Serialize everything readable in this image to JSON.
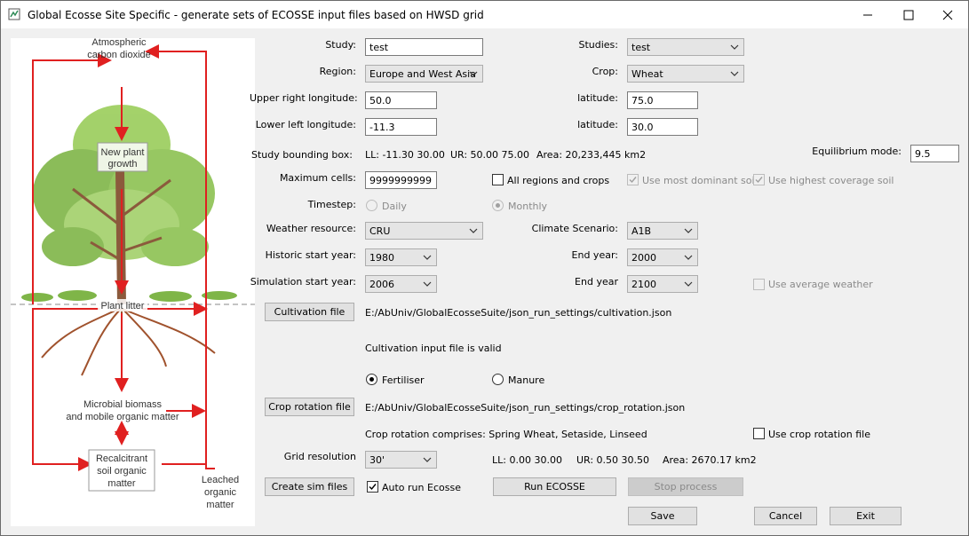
{
  "window": {
    "title": "Global Ecosse Site Specific - generate sets of ECOSSE input files based on HWSD grid"
  },
  "diagram": {
    "co2": [
      "Atmospheric",
      "carbon dioxide"
    ],
    "plant": [
      "New plant",
      "growth"
    ],
    "litter": "Plant litter",
    "microbial": [
      "Microbial biomass",
      "and mobile organic matter"
    ],
    "recalcitrant": [
      "Recalcitrant",
      "soil organic",
      "matter"
    ],
    "leached": [
      "Leached",
      "organic",
      "matter"
    ]
  },
  "form": {
    "study_label": "Study:",
    "study_value": "test",
    "studies_label": "Studies:",
    "studies_value": "test",
    "region_label": "Region:",
    "region_value": "Europe and West Asia",
    "crop_label": "Crop:",
    "crop_value": "Wheat",
    "ur_lon_label": "Upper right longitude:",
    "ur_lon_value": "50.0",
    "ur_lat_label": "latitude:",
    "ur_lat_value": "75.0",
    "ll_lon_label": "Lower left longitude:",
    "ll_lon_value": "-11.3",
    "ll_lat_label": "latitude:",
    "ll_lat_value": "30.0",
    "bbox_label": "Study bounding box:",
    "bbox_ll": "LL: -11.30 30.00",
    "bbox_ur": "UR: 50.00 75.00",
    "bbox_area": "Area: 20,233,445 km2",
    "equil_label": "Equilibrium mode:",
    "equil_value": "9.5",
    "maxcells_label": "Maximum cells:",
    "maxcells_value": "9999999999",
    "all_regions_label": "All regions and crops",
    "dominant_soil_label": "Use most dominant soil",
    "highest_cov_label": "Use highest coverage soil",
    "timestep_label": "Timestep:",
    "daily_label": "Daily",
    "monthly_label": "Monthly",
    "weather_label": "Weather resource:",
    "weather_value": "CRU",
    "climate_label": "Climate Scenario:",
    "climate_value": "A1B",
    "hist_start_label": "Historic start year:",
    "hist_start_value": "1980",
    "hist_end_label": "End year:",
    "hist_end_value": "2000",
    "sim_start_label": "Simulation start year:",
    "sim_start_value": "2006",
    "sim_end_label": "End year",
    "sim_end_value": "2100",
    "avg_weather_label": "Use average weather",
    "cultivation_btn": "Cultivation file",
    "cultivation_path": "E:/AbUniv/GlobalEcosseSuite/json_run_settings/cultivation.json",
    "cultivation_status": "Cultivation input file is valid",
    "fertiliser_label": "Fertiliser",
    "manure_label": "Manure",
    "rotation_btn": "Crop rotation file",
    "rotation_path": "E:/AbUniv/GlobalEcosseSuite/json_run_settings/crop_rotation.json",
    "rotation_comprises": "Crop rotation comprises: Spring Wheat, Setaside, Linseed",
    "use_rotation_label": "Use crop rotation file",
    "grid_label": "Grid resolution",
    "grid_value": "30'",
    "grid_ll": "LL: 0.00 30.00",
    "grid_ur": "UR: 0.50 30.50",
    "grid_area": "Area: 2670.17 km2",
    "create_btn": "Create sim files",
    "auto_run_label": "Auto run Ecosse",
    "run_btn": "Run ECOSSE",
    "stop_btn": "Stop process",
    "save_btn": "Save",
    "cancel_btn": "Cancel",
    "exit_btn": "Exit"
  },
  "colors": {
    "arrow": "#e02020",
    "trunk": "#8b5a3c",
    "leaf": "#8cc152"
  }
}
